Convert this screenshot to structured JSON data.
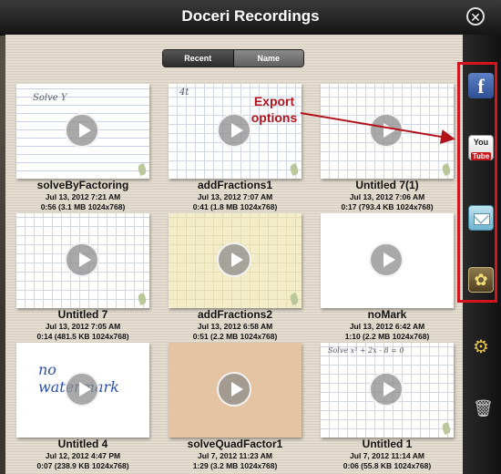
{
  "window": {
    "title": "Doceri Recordings",
    "close_glyph": "✕"
  },
  "sort": {
    "recent_label": "Recent",
    "name_label": "Name",
    "selected": "Name"
  },
  "annotation": {
    "line1": "Export",
    "line2": "options",
    "color": "#b3121b"
  },
  "sidebar": {
    "export_icons": [
      "facebook-icon",
      "youtube-icon",
      "mail-icon",
      "photo-library-icon"
    ],
    "facebook_glyph": "f",
    "youtube_you": "You",
    "youtube_tube": "Tube",
    "photo_glyph": "✿",
    "settings_glyph": "⚙",
    "trash_glyph": "🗑"
  },
  "recordings": [
    {
      "name": "solveByFactoring",
      "date": "Jul 13, 2012 7:21 AM",
      "info": "0:56 (3.1 MB 1024x768)",
      "style": "lined",
      "scribble": "Solve Y"
    },
    {
      "name": "addFractions1",
      "date": "Jul 13, 2012 7:07 AM",
      "info": "0:41 (1.8 MB 1024x768)",
      "style": "grid",
      "scribble": "4t"
    },
    {
      "name": "Untitled 7(1)",
      "date": "Jul 13, 2012 7:06 AM",
      "info": "0:17 (793.4 KB 1024x768)",
      "style": "grid",
      "scribble": ""
    },
    {
      "name": "Untitled 7",
      "date": "Jul 13, 2012 7:05 AM",
      "info": "0:14 (481.5 KB 1024x768)",
      "style": "grid",
      "scribble": ""
    },
    {
      "name": "addFractions2",
      "date": "Jul 13, 2012 6:58 AM",
      "info": "0:51 (2.2 MB 1024x768)",
      "style": "yellow",
      "scribble": ""
    },
    {
      "name": "noMark",
      "date": "Jul 13, 2012 6:42 AM",
      "info": "1:10 (2.2 MB 1024x768)",
      "style": "plain",
      "scribble": ""
    },
    {
      "name": "Untitled 4",
      "date": "Jul 12, 2012 4:47 PM",
      "info": "0:07 (238.9 KB 1024x768)",
      "style": "plain",
      "scribble": "no watermark"
    },
    {
      "name": "solveQuadFactor1",
      "date": "Jul 7, 2012 11:23 AM",
      "info": "1:29 (3.2 MB 1024x768)",
      "style": "peach",
      "scribble": ""
    },
    {
      "name": "Untitled 1",
      "date": "Jul 7, 2012 11:14 AM",
      "info": "0:06 (55.8 KB 1024x768)",
      "style": "grid",
      "scribble": "Solve x² + 2x - 8 = 0"
    }
  ]
}
